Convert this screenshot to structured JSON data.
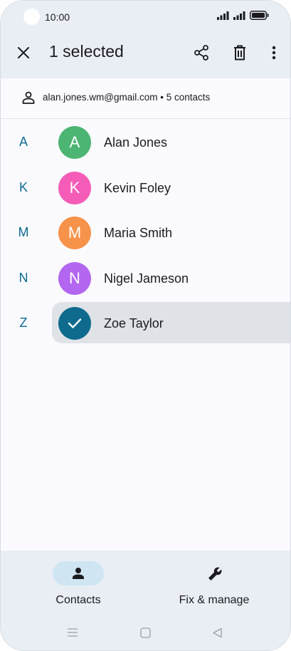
{
  "status_bar": {
    "time": "10:00"
  },
  "app_bar": {
    "title": "1 selected",
    "close_icon": "close-icon",
    "share_icon": "share-icon",
    "delete_icon": "trash-icon",
    "more_icon": "more-vert-icon"
  },
  "account": {
    "text": "alan.jones.wm@gmail.com • 5 contacts"
  },
  "contacts": [
    {
      "section": "A",
      "initial": "A",
      "name": "Alan Jones",
      "color": "#4cb573",
      "selected": false
    },
    {
      "section": "K",
      "initial": "K",
      "name": "Kevin Foley",
      "color": "#f55cb8",
      "selected": false
    },
    {
      "section": "M",
      "initial": "M",
      "name": "Maria Smith",
      "color": "#f7924a",
      "selected": false
    },
    {
      "section": "N",
      "initial": "N",
      "name": "Nigel Jameson",
      "color": "#b366f0",
      "selected": false
    },
    {
      "section": "Z",
      "initial": "",
      "name": "Zoe Taylor",
      "color": "#0e6b8e",
      "selected": true
    }
  ],
  "bottom_nav": {
    "items": [
      {
        "label": "Contacts",
        "icon": "person-icon",
        "active": true
      },
      {
        "label": "Fix & manage",
        "icon": "wrench-icon",
        "active": false
      }
    ]
  }
}
